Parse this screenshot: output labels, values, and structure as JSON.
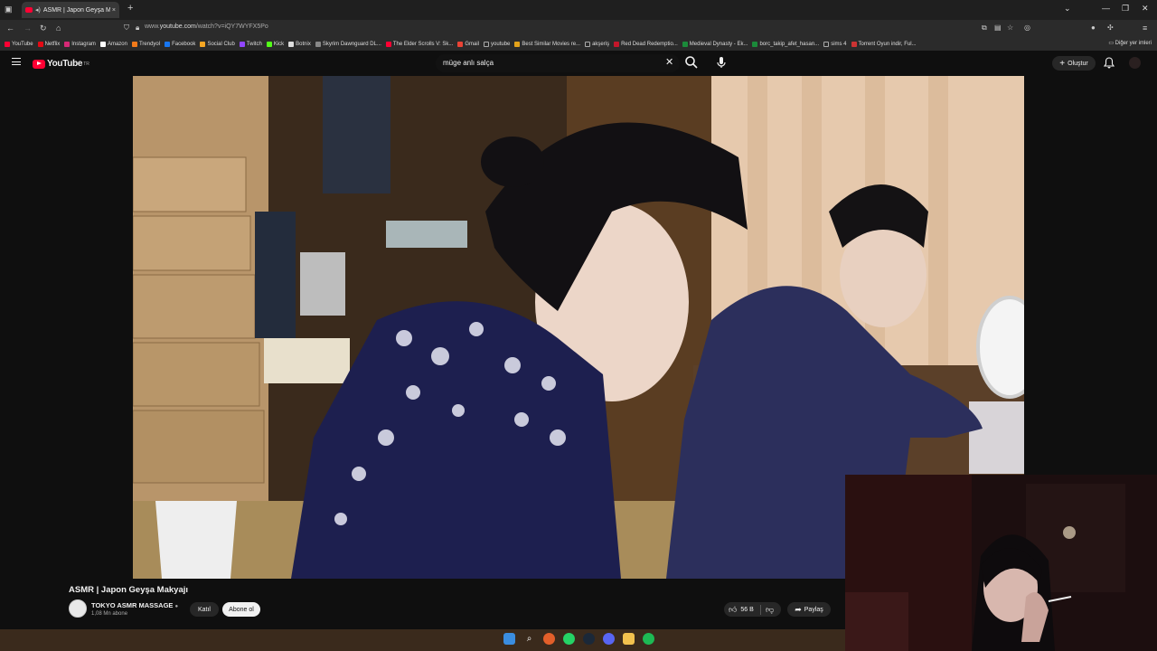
{
  "browser": {
    "tab_title": "ASMR | Japon Geyşa Makyajı",
    "tab_close": "×",
    "new_tab": "+",
    "url_prefix": "www.",
    "url_domain": "youtube.com",
    "url_path": "/watch?v=iQY7WYFX5Po",
    "bookmarks": [
      {
        "label": "YouTube",
        "color": "#ff0033"
      },
      {
        "label": "Netflix",
        "color": "#e50914"
      },
      {
        "label": "Instagram",
        "color": "#d62976"
      },
      {
        "label": "Amazon",
        "color": "#ffffff"
      },
      {
        "label": "Trendyol",
        "color": "#f27a1a"
      },
      {
        "label": "Facebook",
        "color": "#1877f2"
      },
      {
        "label": "Social Club",
        "color": "#f5a623"
      },
      {
        "label": "Twitch",
        "color": "#9146ff"
      },
      {
        "label": "Kick",
        "color": "#53fc18"
      },
      {
        "label": "Botnix",
        "color": "#dddddd"
      },
      {
        "label": "Skyrim Dawnguard DL...",
        "color": "#888888"
      },
      {
        "label": "The Elder Scrolls V: Sk...",
        "color": "#ff0033"
      },
      {
        "label": "Gmail",
        "color": "#ea4335"
      },
      {
        "label": "youtube",
        "color": "#aaaaaa"
      },
      {
        "label": "Best Similar Movies re...",
        "color": "#e3a21a"
      },
      {
        "label": "akşeriş",
        "color": "#aaaaaa"
      },
      {
        "label": "Red Dead Redemptio...",
        "color": "#c4162a"
      },
      {
        "label": "Medieval Dynasty - Ek...",
        "color": "#1b8a3a"
      },
      {
        "label": "borc_takip_afet_hasan...",
        "color": "#1b8a3a"
      },
      {
        "label": "sims 4",
        "color": "#aaaaaa"
      },
      {
        "label": "Torrent Oyun indir, Ful...",
        "color": "#cc3333"
      }
    ],
    "other_bookmarks": "Diğer yer imleri"
  },
  "youtube": {
    "logo_text": "YouTube",
    "logo_country": "TR",
    "search_query": "müge anlı salça",
    "create_label": "Oluştur",
    "video_title": "ASMR | Japon Geyşa Makyajı",
    "channel_name": "TOKYO ASMR MASSAGE",
    "subscribers": "1,08 Mn abone",
    "join_label": "Katıl",
    "subscribe_label": "Abone ol",
    "like_count": "56 B",
    "share_label": "Paylaş"
  },
  "colors": {
    "accent": "#ff0033",
    "background": "#0f0f0f",
    "pill": "#272727"
  }
}
